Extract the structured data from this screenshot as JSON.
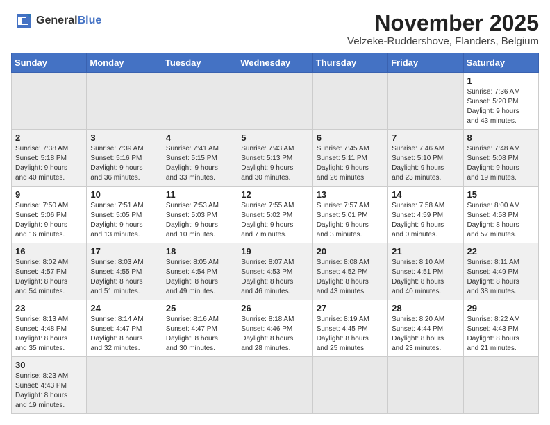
{
  "header": {
    "logo_general": "General",
    "logo_blue": "Blue",
    "month_title": "November 2025",
    "location": "Velzeke-Ruddershove, Flanders, Belgium"
  },
  "weekdays": [
    "Sunday",
    "Monday",
    "Tuesday",
    "Wednesday",
    "Thursday",
    "Friday",
    "Saturday"
  ],
  "weeks": [
    [
      {
        "day": "",
        "info": ""
      },
      {
        "day": "",
        "info": ""
      },
      {
        "day": "",
        "info": ""
      },
      {
        "day": "",
        "info": ""
      },
      {
        "day": "",
        "info": ""
      },
      {
        "day": "",
        "info": ""
      },
      {
        "day": "1",
        "info": "Sunrise: 7:36 AM\nSunset: 5:20 PM\nDaylight: 9 hours\nand 43 minutes."
      }
    ],
    [
      {
        "day": "2",
        "info": "Sunrise: 7:38 AM\nSunset: 5:18 PM\nDaylight: 9 hours\nand 40 minutes."
      },
      {
        "day": "3",
        "info": "Sunrise: 7:39 AM\nSunset: 5:16 PM\nDaylight: 9 hours\nand 36 minutes."
      },
      {
        "day": "4",
        "info": "Sunrise: 7:41 AM\nSunset: 5:15 PM\nDaylight: 9 hours\nand 33 minutes."
      },
      {
        "day": "5",
        "info": "Sunrise: 7:43 AM\nSunset: 5:13 PM\nDaylight: 9 hours\nand 30 minutes."
      },
      {
        "day": "6",
        "info": "Sunrise: 7:45 AM\nSunset: 5:11 PM\nDaylight: 9 hours\nand 26 minutes."
      },
      {
        "day": "7",
        "info": "Sunrise: 7:46 AM\nSunset: 5:10 PM\nDaylight: 9 hours\nand 23 minutes."
      },
      {
        "day": "8",
        "info": "Sunrise: 7:48 AM\nSunset: 5:08 PM\nDaylight: 9 hours\nand 19 minutes."
      }
    ],
    [
      {
        "day": "9",
        "info": "Sunrise: 7:50 AM\nSunset: 5:06 PM\nDaylight: 9 hours\nand 16 minutes."
      },
      {
        "day": "10",
        "info": "Sunrise: 7:51 AM\nSunset: 5:05 PM\nDaylight: 9 hours\nand 13 minutes."
      },
      {
        "day": "11",
        "info": "Sunrise: 7:53 AM\nSunset: 5:03 PM\nDaylight: 9 hours\nand 10 minutes."
      },
      {
        "day": "12",
        "info": "Sunrise: 7:55 AM\nSunset: 5:02 PM\nDaylight: 9 hours\nand 7 minutes."
      },
      {
        "day": "13",
        "info": "Sunrise: 7:57 AM\nSunset: 5:01 PM\nDaylight: 9 hours\nand 3 minutes."
      },
      {
        "day": "14",
        "info": "Sunrise: 7:58 AM\nSunset: 4:59 PM\nDaylight: 9 hours\nand 0 minutes."
      },
      {
        "day": "15",
        "info": "Sunrise: 8:00 AM\nSunset: 4:58 PM\nDaylight: 8 hours\nand 57 minutes."
      }
    ],
    [
      {
        "day": "16",
        "info": "Sunrise: 8:02 AM\nSunset: 4:57 PM\nDaylight: 8 hours\nand 54 minutes."
      },
      {
        "day": "17",
        "info": "Sunrise: 8:03 AM\nSunset: 4:55 PM\nDaylight: 8 hours\nand 51 minutes."
      },
      {
        "day": "18",
        "info": "Sunrise: 8:05 AM\nSunset: 4:54 PM\nDaylight: 8 hours\nand 49 minutes."
      },
      {
        "day": "19",
        "info": "Sunrise: 8:07 AM\nSunset: 4:53 PM\nDaylight: 8 hours\nand 46 minutes."
      },
      {
        "day": "20",
        "info": "Sunrise: 8:08 AM\nSunset: 4:52 PM\nDaylight: 8 hours\nand 43 minutes."
      },
      {
        "day": "21",
        "info": "Sunrise: 8:10 AM\nSunset: 4:51 PM\nDaylight: 8 hours\nand 40 minutes."
      },
      {
        "day": "22",
        "info": "Sunrise: 8:11 AM\nSunset: 4:49 PM\nDaylight: 8 hours\nand 38 minutes."
      }
    ],
    [
      {
        "day": "23",
        "info": "Sunrise: 8:13 AM\nSunset: 4:48 PM\nDaylight: 8 hours\nand 35 minutes."
      },
      {
        "day": "24",
        "info": "Sunrise: 8:14 AM\nSunset: 4:47 PM\nDaylight: 8 hours\nand 32 minutes."
      },
      {
        "day": "25",
        "info": "Sunrise: 8:16 AM\nSunset: 4:47 PM\nDaylight: 8 hours\nand 30 minutes."
      },
      {
        "day": "26",
        "info": "Sunrise: 8:18 AM\nSunset: 4:46 PM\nDaylight: 8 hours\nand 28 minutes."
      },
      {
        "day": "27",
        "info": "Sunrise: 8:19 AM\nSunset: 4:45 PM\nDaylight: 8 hours\nand 25 minutes."
      },
      {
        "day": "28",
        "info": "Sunrise: 8:20 AM\nSunset: 4:44 PM\nDaylight: 8 hours\nand 23 minutes."
      },
      {
        "day": "29",
        "info": "Sunrise: 8:22 AM\nSunset: 4:43 PM\nDaylight: 8 hours\nand 21 minutes."
      }
    ],
    [
      {
        "day": "30",
        "info": "Sunrise: 8:23 AM\nSunset: 4:43 PM\nDaylight: 8 hours\nand 19 minutes."
      },
      {
        "day": "",
        "info": ""
      },
      {
        "day": "",
        "info": ""
      },
      {
        "day": "",
        "info": ""
      },
      {
        "day": "",
        "info": ""
      },
      {
        "day": "",
        "info": ""
      },
      {
        "day": "",
        "info": ""
      }
    ]
  ]
}
